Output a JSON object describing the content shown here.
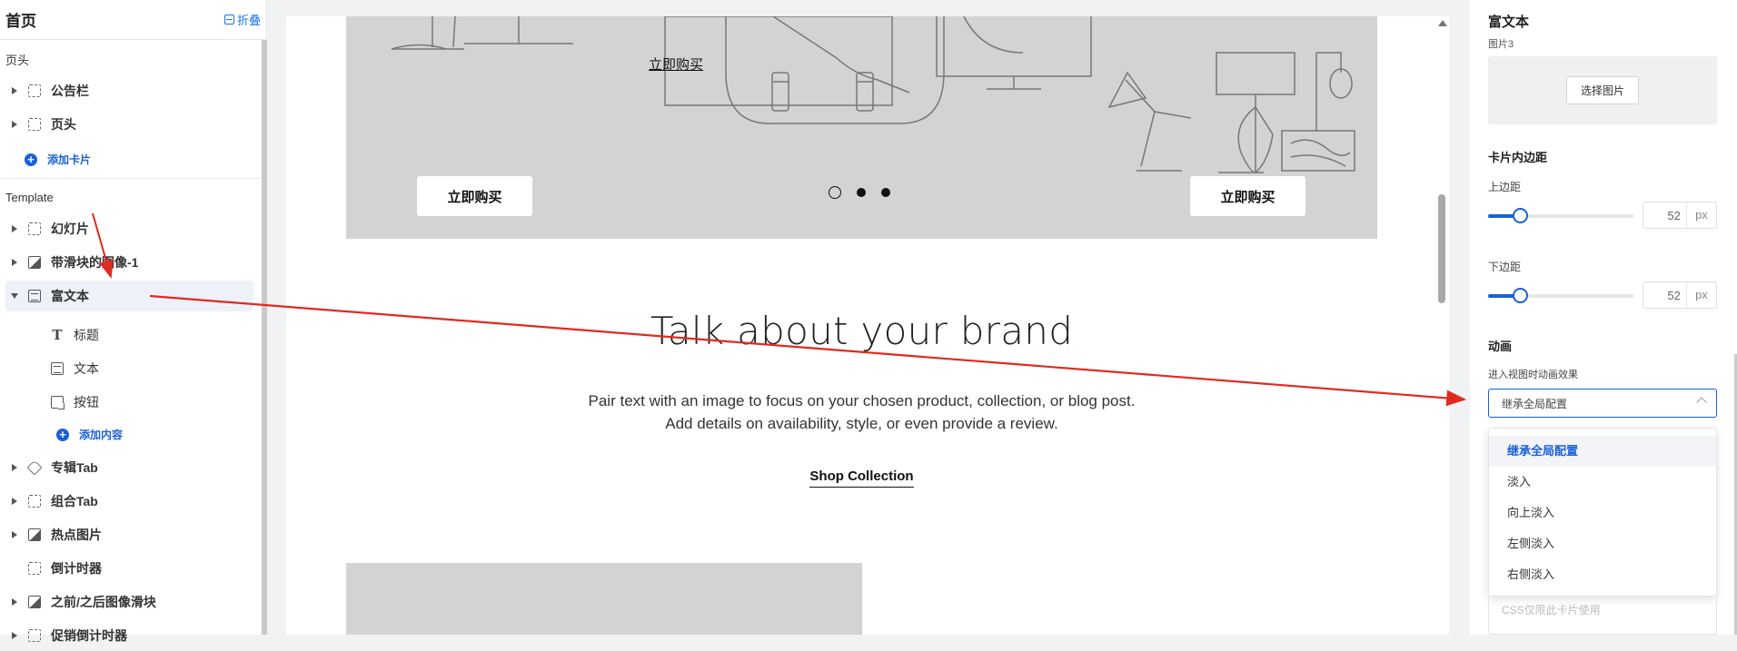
{
  "left": {
    "title": "首页",
    "collapse": "折叠",
    "header_section": "页头",
    "header_items": [
      "公告栏",
      "页头"
    ],
    "add_card": "添加卡片",
    "template_section": "Template",
    "template_items": [
      "幻灯片",
      "带滑块的图像-1",
      "富文本"
    ],
    "sub_items": [
      "标题",
      "文本",
      "按钮"
    ],
    "add_content": "添加内容",
    "more_items": [
      "专辑Tab",
      "组合Tab",
      "热点图片",
      "倒计时器",
      "之前/之后图像滑块",
      "促销倒计时器"
    ]
  },
  "canvas": {
    "hero_link": "立即购买",
    "hero_buttons": [
      "立即购买",
      "立即购买"
    ],
    "brand_title": "Talk about your brand",
    "brand_text_1": "Pair text with an image to focus on your chosen product, collection, or blog post.",
    "brand_text_2": "Add details on availability, style, or even provide a review.",
    "shop_link": "Shop Collection"
  },
  "right": {
    "title": "富文本",
    "image_label": "图片3",
    "choose_image": "选择图片",
    "padding_head": "卡片内边距",
    "top_label": "上边距",
    "top_value": "52",
    "top_level": 0.22,
    "bottom_label": "下边距",
    "bottom_value": "52",
    "bottom_level": 0.22,
    "unit": "px",
    "anim_head": "动画",
    "anim_label": "进入视图时动画效果",
    "anim_value": "继承全局配置",
    "anim_options": [
      "继承全局配置",
      "淡入",
      "向上淡入",
      "左侧淡入",
      "右侧淡入"
    ],
    "css_placeholder": "CSS仅限此卡片使用"
  },
  "colors": {
    "accent": "#1a60d8",
    "annotation": "#e02a1f",
    "hero_bg": "#d3d3d3"
  }
}
